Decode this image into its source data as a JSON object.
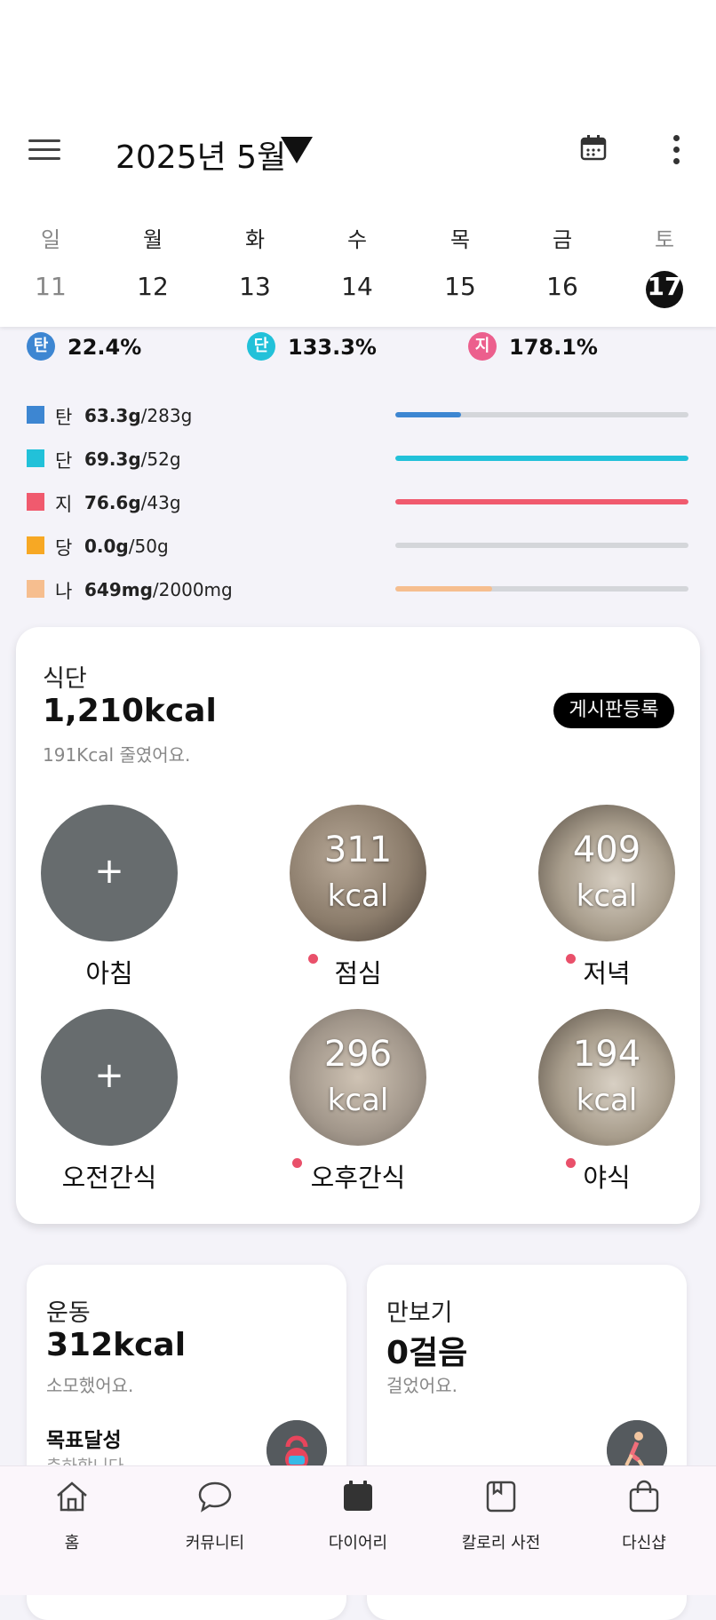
{
  "header": {
    "month_title": "2025년 5월",
    "weekdays": [
      "일",
      "월",
      "화",
      "수",
      "목",
      "금",
      "토"
    ],
    "days": [
      "11",
      "12",
      "13",
      "14",
      "15",
      "16",
      "17"
    ],
    "selected_day": "17"
  },
  "macro_percent": [
    {
      "badge": "탄",
      "value": "22.4%",
      "color": "#3d86d2"
    },
    {
      "badge": "단",
      "value": "133.3%",
      "color": "#22c1d9"
    },
    {
      "badge": "지",
      "value": "178.1%",
      "color": "#ec5f8d"
    }
  ],
  "nutrients": [
    {
      "label": "탄",
      "amount": "63.3g",
      "target": "/283g",
      "color": "#3d86d2",
      "progress": 0.224
    },
    {
      "label": "단",
      "amount": "69.3g",
      "target": "/52g",
      "color": "#22c1d9",
      "progress": 1.0
    },
    {
      "label": "지",
      "amount": "76.6g",
      "target": "/43g",
      "color": "#f05a6e",
      "progress": 1.0
    },
    {
      "label": "당",
      "amount": "0.0g",
      "target": "/50g",
      "color": "#f7a824",
      "progress": 0.0
    },
    {
      "label": "나",
      "amount": "649mg",
      "target": "/2000mg",
      "color": "#f6be8f",
      "progress": 0.33
    }
  ],
  "diet": {
    "title": "식단",
    "kcal": "1,210kcal",
    "sub": "191Kcal 줄였어요.",
    "board_button": "게시판등록",
    "meals": [
      {
        "label": "아침",
        "add": "+",
        "kcal_value": "",
        "kcal_unit": ""
      },
      {
        "label": "점심",
        "add": "",
        "kcal_value": "311",
        "kcal_unit": "kcal"
      },
      {
        "label": "저녁",
        "add": "",
        "kcal_value": "409",
        "kcal_unit": "kcal"
      },
      {
        "label": "오전간식",
        "add": "+",
        "kcal_value": "",
        "kcal_unit": ""
      },
      {
        "label": "오후간식",
        "add": "",
        "kcal_value": "296",
        "kcal_unit": "kcal"
      },
      {
        "label": "야식",
        "add": "",
        "kcal_value": "194",
        "kcal_unit": "kcal"
      }
    ]
  },
  "exercise": {
    "title": "운동",
    "value": "312kcal",
    "sub": "소모했어요.",
    "goal": "목표달성",
    "goal_sub": "축하합니다"
  },
  "steps": {
    "title": "만보기",
    "value": "0걸음",
    "sub": "걸었어요."
  },
  "bottom_nav": [
    "홈",
    "커뮤니티",
    "다이어리",
    "칼로리 사전",
    "다신샵"
  ]
}
